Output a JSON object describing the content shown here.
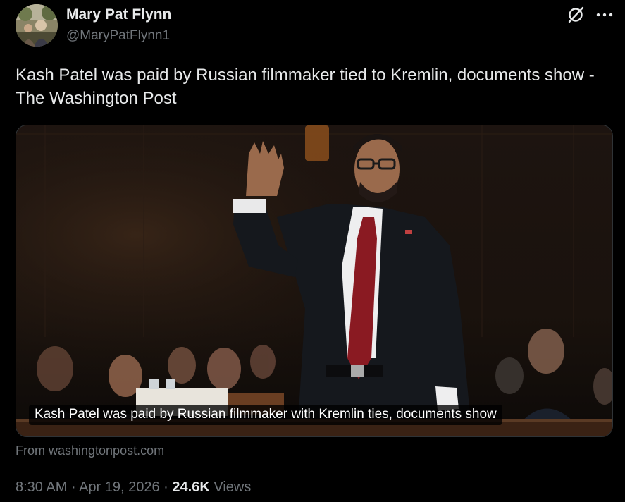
{
  "author": {
    "display_name": "Mary Pat Flynn",
    "handle": "@MaryPatFlynn1",
    "avatar_icon": "avatar-photo"
  },
  "header_actions": {
    "grok_icon": "grok-icon",
    "more_icon": "more-options-icon"
  },
  "tweet": {
    "text": "Kash Patel was paid by Russian filmmaker tied to Kremlin, documents show - The Washington Post"
  },
  "link_card": {
    "title": "Kash Patel was paid by Russian filmmaker with Kremlin ties, documents show",
    "source": "From washingtonpost.com"
  },
  "meta": {
    "time": "8:30 AM",
    "separator": "·",
    "date": "Apr 19, 2026",
    "views_count": "24.6K",
    "views_label": "Views"
  },
  "colors": {
    "background": "#000000",
    "primary_text": "#e7e9ea",
    "secondary_text": "#71767b",
    "card_border": "#2f3336"
  }
}
